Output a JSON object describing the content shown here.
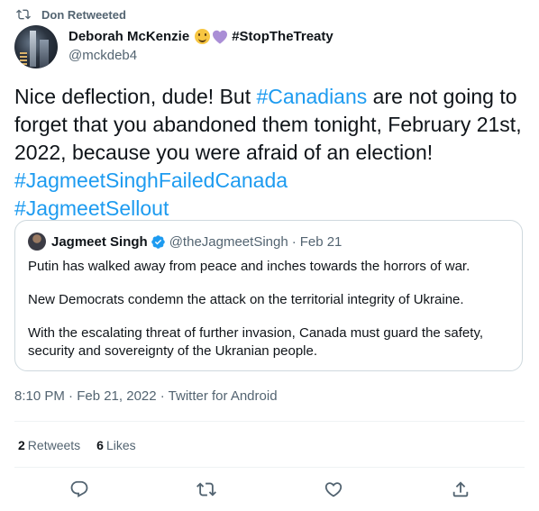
{
  "social_context": {
    "text": "Don Retweeted",
    "icon": "retweet-icon"
  },
  "author": {
    "display_name": "Deborah McKenzie",
    "hashtag": "#StopTheTreaty",
    "handle": "@mckdeb4",
    "emojis": [
      "slightly-smiling-face",
      "purple-heart"
    ]
  },
  "tweet": {
    "text_1": "Nice deflection, dude! But ",
    "tag_1": "#Canadians",
    "text_2": " are not going to forget that you abandoned them tonight, February 21st, 2022, because you were afraid of an election! ",
    "tag_2": "#JagmeetSinghFailedCanada",
    "tag_3": "#JagmeetSellout"
  },
  "quoted_tweet": {
    "name": "Jagmeet Singh",
    "handle": "@theJagmeetSingh",
    "separator": "·",
    "date": "Feb 21",
    "paragraphs": [
      "Putin has walked away from peace and inches towards the horrors of war.",
      "New Democrats condemn the attack on the territorial integrity of Ukraine.",
      "With the escalating threat of further invasion, Canada must guard the safety, security and sovereignty of the Ukranian people."
    ]
  },
  "meta": {
    "text": "8:10 PM · Feb 21, 2022 · Twitter for Android"
  },
  "stats": {
    "retweets_count": "2",
    "retweets_label": "Retweets",
    "likes_count": "6",
    "likes_label": "Likes"
  },
  "colors": {
    "link": "#1d9bf0",
    "secondary": "#536471",
    "border": "#cfd9de",
    "divider": "#eff3f4"
  },
  "actions": [
    "reply-icon",
    "retweet-icon",
    "like-icon",
    "share-icon"
  ]
}
